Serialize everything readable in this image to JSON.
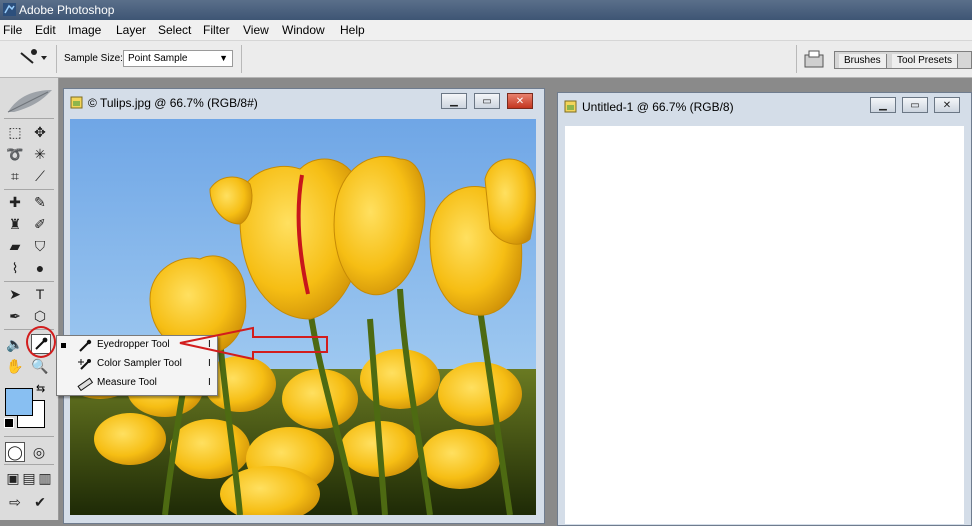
{
  "app": {
    "title": "Adobe Photoshop"
  },
  "menu": [
    "File",
    "Edit",
    "Image",
    "Layer",
    "Select",
    "Filter",
    "View",
    "Window",
    "Help"
  ],
  "options": {
    "sample_size_label": "Sample Size:",
    "sample_size_value": "Point Sample",
    "tabs": [
      "Brushes",
      "Tool Presets"
    ]
  },
  "documents": [
    {
      "title": "© Tulips.jpg @ 66.7% (RGB/8#)"
    },
    {
      "title": "Untitled-1 @ 66.7% (RGB/8)"
    }
  ],
  "flyout": {
    "items": [
      {
        "label": "Eyedropper Tool",
        "shortcut": "I",
        "icon": "eyedropper-icon",
        "selected": true
      },
      {
        "label": "Color Sampler Tool",
        "shortcut": "I",
        "icon": "color-sampler-icon",
        "selected": false
      },
      {
        "label": "Measure Tool",
        "shortcut": "I",
        "icon": "ruler-icon",
        "selected": false
      }
    ]
  },
  "colors": {
    "foreground": "#88bff2",
    "background": "#ffffff",
    "annotation": "#d21d1d",
    "title_bar": "#3e5574"
  }
}
